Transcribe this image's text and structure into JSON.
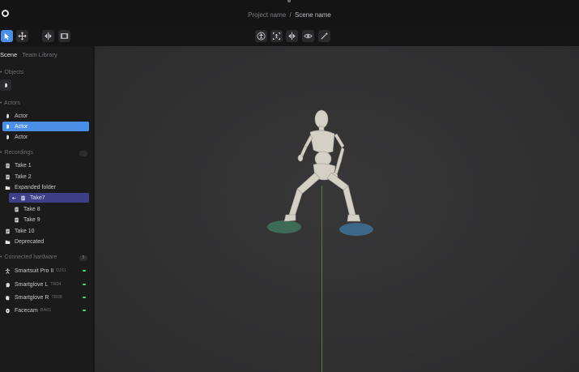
{
  "titlebar": {
    "project": "Project name",
    "separator": "/",
    "scene": "Scene name"
  },
  "toolbar": {
    "left_tools": [
      "select-pointer-icon",
      "move-icon",
      "mirror-icon",
      "film-icon"
    ],
    "center_tools": [
      "body-icon",
      "frame-capture-icon",
      "mirror-icon",
      "eye-icon",
      "magic-wand-icon"
    ],
    "accent": "#4a8fe7"
  },
  "sidebar": {
    "tabs": [
      {
        "label": "Scene",
        "active": true
      },
      {
        "label": "Team Library",
        "active": false
      }
    ],
    "objects": {
      "title": "Objects"
    },
    "actors": {
      "title": "Actors",
      "items": [
        {
          "label": "Actor",
          "selected": false
        },
        {
          "label": "Actor",
          "selected": true
        },
        {
          "label": "Actor",
          "selected": false
        }
      ]
    },
    "recordings": {
      "title": "Recordings",
      "count": "",
      "items": [
        {
          "label": "Take 1",
          "icon": "file-icon"
        },
        {
          "label": "Take 2",
          "icon": "file-icon"
        },
        {
          "label": "Expanded folder",
          "icon": "folder-icon"
        },
        {
          "label": "Take7",
          "icon": "file-icon",
          "selected": true
        },
        {
          "label": "Take 8",
          "icon": "file-icon"
        },
        {
          "label": "Take 9",
          "icon": "file-icon"
        },
        {
          "label": "Take 10",
          "icon": "file-icon"
        },
        {
          "label": "Deprecated",
          "icon": "folder-icon"
        }
      ]
    },
    "hardware": {
      "title": "Connected hardware",
      "count": "5",
      "items": [
        {
          "label": "Smartsuit Pro II",
          "sub": "D211",
          "icon": "suit-icon"
        },
        {
          "label": "Smartglove L",
          "sub": "TR04",
          "icon": "glove-icon"
        },
        {
          "label": "Smartglove R",
          "sub": "TR08",
          "icon": "glove-icon"
        },
        {
          "label": "Facecam",
          "sub": "BA01",
          "icon": "facecam-icon"
        }
      ],
      "status_color": "#4ade80"
    }
  }
}
